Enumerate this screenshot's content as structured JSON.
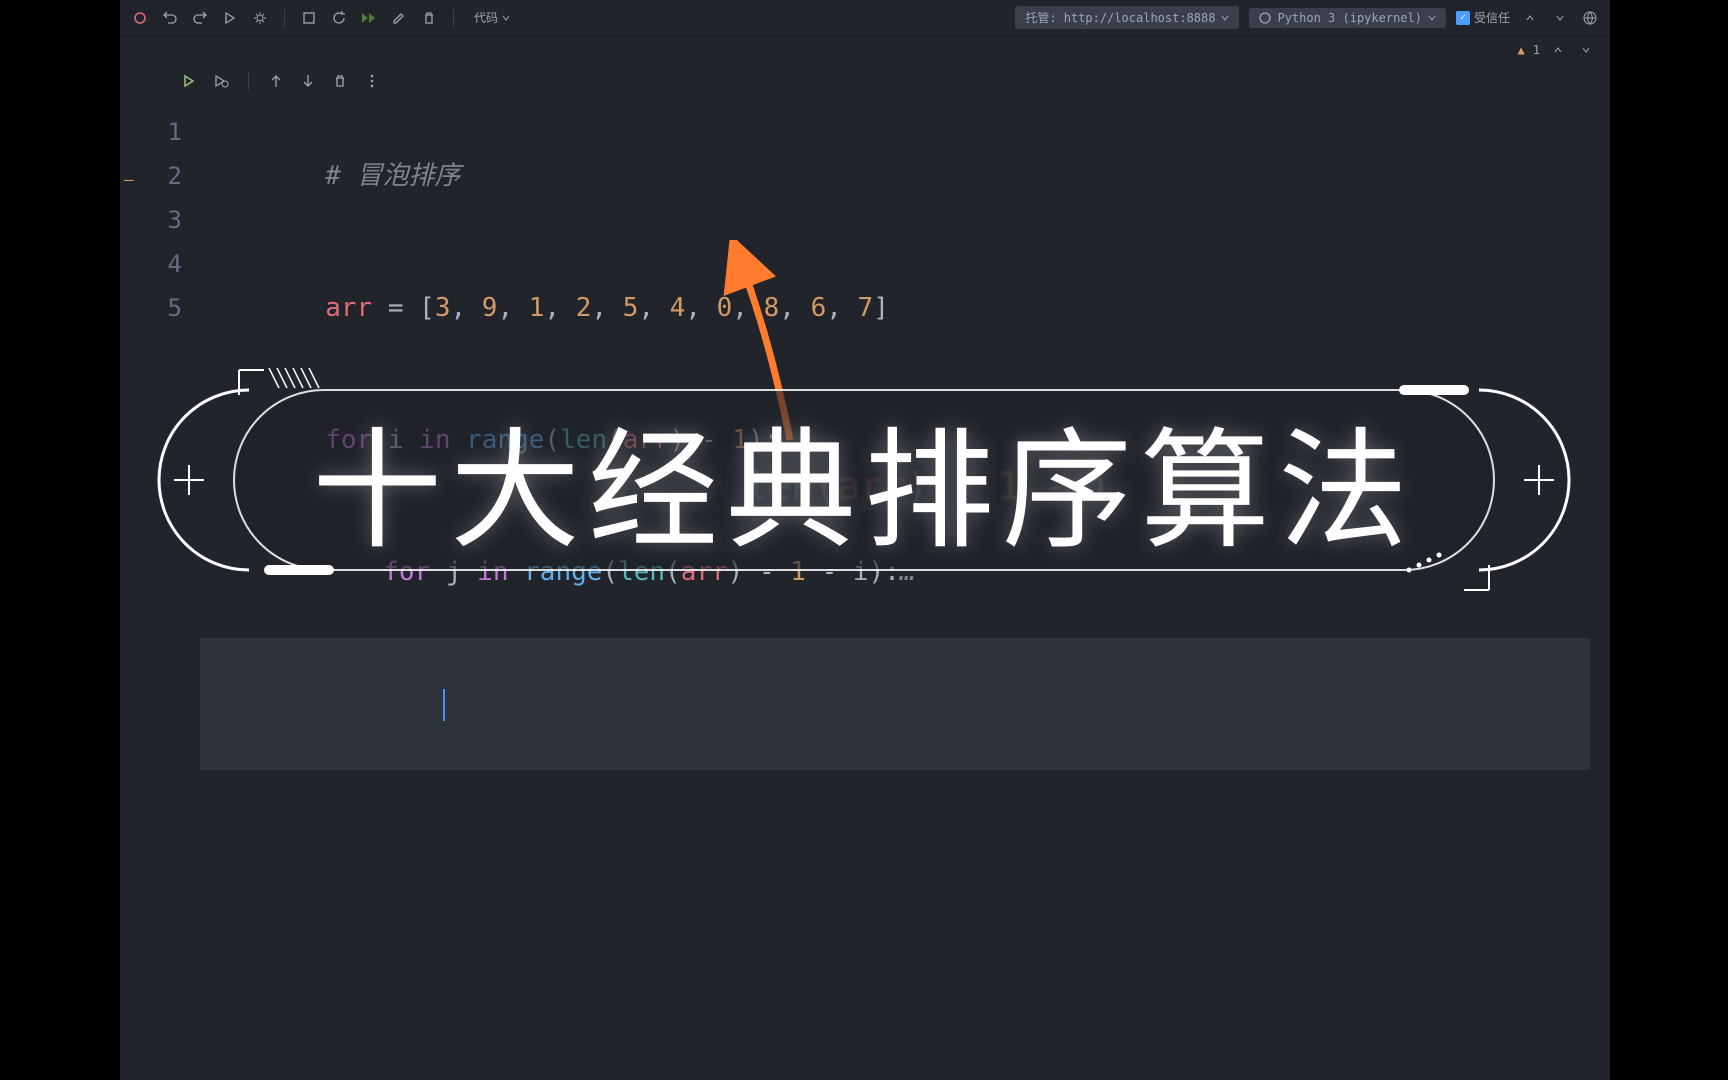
{
  "toolbar": {
    "code_dropdown": "代码",
    "kernel_host": "托管: http://localhost:8888",
    "kernel_name": "Python 3 (ipykernel)",
    "trust_label": "受信任"
  },
  "warnings": {
    "count": "1"
  },
  "code": {
    "line1_comment": "# 冒泡排序",
    "line2_var": "arr",
    "line2_eq": " = ",
    "line2_lb": "[",
    "line2_nums": [
      "3",
      "9",
      "1",
      "2",
      "5",
      "4",
      "0",
      "8",
      "6",
      "7"
    ],
    "line2_rb": "]",
    "line3_for": "for",
    "line3_i": " i ",
    "line3_in": "in",
    "line3_range": " range",
    "line3_lp": "(",
    "line3_len": "len",
    "line3_lp2": "(",
    "line3_arr": "arr",
    "line3_rp": ")",
    "line3_minus": " - ",
    "line3_one": "1",
    "line3_rp2": ")",
    "line3_colon": ":",
    "line4_for": "for",
    "line4_j": " j ",
    "line4_in": "in",
    "line4_range": " range",
    "line4_lp": "(",
    "line4_len": "len",
    "line4_lp2": "(",
    "line4_arr": "arr",
    "line4_rp": ")",
    "line4_m1": " - ",
    "line4_one": "1",
    "line4_m2": " - ",
    "line4_iv": "i",
    "line4_rp2": ")",
    "line4_colon": ":",
    "line4_dots": "…"
  },
  "line_numbers": [
    "1",
    "2",
    "3",
    "4",
    "5"
  ],
  "faded": {
    "len": "len",
    "lp": "(",
    "arr": "arr",
    "rp": ")",
    "m1": " - ",
    "one": "1",
    "m2": " - ",
    "i": "i"
  },
  "title": "十大经典排序算法"
}
